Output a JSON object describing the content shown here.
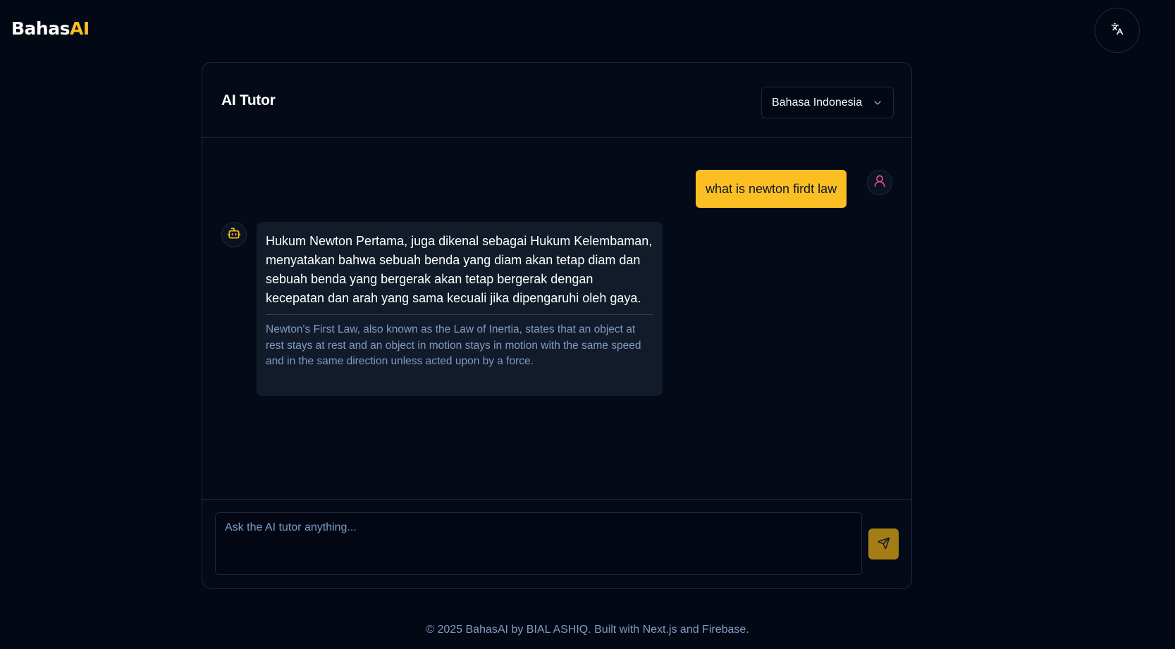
{
  "header": {
    "logo_main": "Bahas",
    "logo_accent": "AI",
    "translate_icon": "translate-icon"
  },
  "card": {
    "title": "AI Tutor",
    "language_select": {
      "selected": "Bahasa Indonesia"
    }
  },
  "chat": {
    "messages": [
      {
        "role": "user",
        "text": "what is newton firdt law",
        "icon": "user-icon"
      },
      {
        "role": "assistant",
        "icon": "bot-icon",
        "text": "Hukum Newton Pertama, juga dikenal sebagai Hukum Kelembaman, menyatakan bahwa sebuah benda yang diam akan tetap diam dan sebuah benda yang bergerak akan tetap bergerak dengan kecepatan dan arah yang sama kecuali jika dipengaruhi oleh gaya.",
        "translation": "Newton's First Law, also known as the Law of Inertia, states that an object at rest stays at rest and an object in motion stays in motion with the same speed and in the same direction unless acted upon by a force."
      }
    ]
  },
  "composer": {
    "placeholder": "Ask the AI tutor anything...",
    "send_icon": "send-icon"
  },
  "footer": {
    "text": "© 2025 BahasAI by BIAL ASHIQ. Built with Next.js and Firebase."
  },
  "colors": {
    "background": "#030815",
    "accent": "#fbbf24",
    "border": "#1e293b",
    "muted_text": "#7f9cc4",
    "bot_bubble": "#111b29",
    "user_icon": "#ec4899"
  }
}
